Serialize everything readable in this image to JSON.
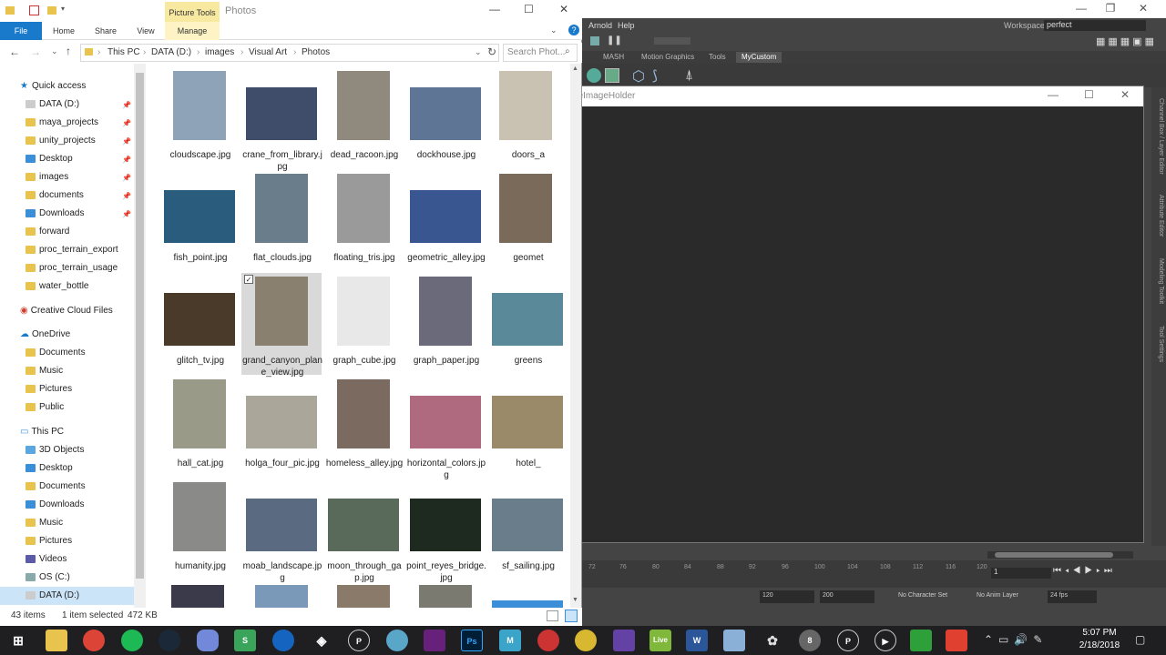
{
  "explorer": {
    "contextual_tab": "Picture Tools",
    "title": "Photos",
    "ribbon_tabs": [
      "File",
      "Home",
      "Share",
      "View",
      "Manage"
    ],
    "breadcrumb": [
      "This PC",
      "DATA (D:)",
      "images",
      "Visual Art",
      "Photos"
    ],
    "search_placeholder": "Search Phot...",
    "nav": {
      "quick_access": "Quick access",
      "quick_items": [
        "DATA (D:)",
        "maya_projects",
        "unity_projects",
        "Desktop",
        "images",
        "documents",
        "Downloads",
        "forward",
        "proc_terrain_export",
        "proc_terrain_usage",
        "water_bottle"
      ],
      "creative_cloud": "Creative Cloud Files",
      "onedrive": "OneDrive",
      "onedrive_items": [
        "Documents",
        "Music",
        "Pictures",
        "Public"
      ],
      "this_pc": "This PC",
      "pc_items": [
        "3D Objects",
        "Desktop",
        "Documents",
        "Downloads",
        "Music",
        "Pictures",
        "Videos",
        "OS (C:)",
        "DATA (D:)"
      ]
    },
    "files": [
      {
        "name": "cloudscape.jpg",
        "color": "#8ea3b8"
      },
      {
        "name": "crane_from_library.jpg",
        "color": "#3f4d6b"
      },
      {
        "name": "dead_racoon.jpg",
        "color": "#8f8a7d"
      },
      {
        "name": "dockhouse.jpg",
        "color": "#5f7596"
      },
      {
        "name": "doors_a",
        "color": "#c9c1b2"
      },
      {
        "name": "fish_point.jpg",
        "color": "#2a5c7d"
      },
      {
        "name": "flat_clouds.jpg",
        "color": "#6a7d8a"
      },
      {
        "name": "floating_tris.jpg",
        "color": "#9a9a9a"
      },
      {
        "name": "geometric_alley.jpg",
        "color": "#3a5690"
      },
      {
        "name": "geomet",
        "color": "#7a6a5a"
      },
      {
        "name": "glitch_tv.jpg",
        "color": "#4a3a2a"
      },
      {
        "name": "grand_canyon_plane_view.jpg",
        "color": "#8a8070"
      },
      {
        "name": "graph_cube.jpg",
        "color": "#e8e8e8"
      },
      {
        "name": "graph_paper.jpg",
        "color": "#6a6a7a"
      },
      {
        "name": "greens",
        "color": "#5a8a9a"
      },
      {
        "name": "hall_cat.jpg",
        "color": "#9a9a88"
      },
      {
        "name": "holga_four_pic.jpg",
        "color": "#aaa69a"
      },
      {
        "name": "homeless_alley.jpg",
        "color": "#7a6a60"
      },
      {
        "name": "horizontal_colors.jpg",
        "color": "#b06a80"
      },
      {
        "name": "hotel_",
        "color": "#9a8a6a"
      },
      {
        "name": "humanity.jpg",
        "color": "#8a8a88"
      },
      {
        "name": "moab_landscape.jpg",
        "color": "#5a6a80"
      },
      {
        "name": "moon_through_gap.jpg",
        "color": "#5a6a5a"
      },
      {
        "name": "point_reyes_bridge.jpg",
        "color": "#1e2a20"
      },
      {
        "name": "sf_sailing.jpg",
        "color": "#6a7d8a"
      }
    ],
    "status_items": "43 items",
    "status_selected": "1 item selected",
    "status_size": "472 KB"
  },
  "maya": {
    "menu": [
      "Arnold",
      "Help"
    ],
    "workspace_label": "Workspace :",
    "workspace_value": "perfect",
    "shelf_tabs": [
      "MASH",
      "Motion Graphics",
      "Tools",
      "MyCustom"
    ],
    "side_tabs": [
      "Channel Box / Layer Editor",
      "Attribute Editor",
      "Modeling Toolkit",
      "Tool Settings"
    ],
    "timeline_ticks": [
      "72",
      "76",
      "80",
      "84",
      "88",
      "92",
      "96",
      "100",
      "104",
      "108",
      "112",
      "116",
      "120"
    ],
    "current_frame": "1",
    "range_end": "120",
    "range_max": "200",
    "character_set": "No Character Set",
    "anim_layer": "No Anim Layer",
    "fps": "24 fps"
  },
  "refwin": {
    "title": "ReferenceImageHolder"
  },
  "taskbar": {
    "time": "5:07 PM",
    "date": "2/18/2018",
    "apps": [
      "Start",
      "File Explorer",
      "Chrome",
      "Spotify",
      "Steam",
      "Discord",
      "Maps",
      "Unity",
      "App",
      "Blender",
      "Visual Studio",
      "Photoshop",
      "Maya",
      "App",
      "Sketch",
      "Twitch",
      "Live",
      "Word",
      "App",
      "Slack",
      "Mail",
      "App",
      "Media",
      "Clip Studio",
      "Screen Recorder"
    ]
  }
}
